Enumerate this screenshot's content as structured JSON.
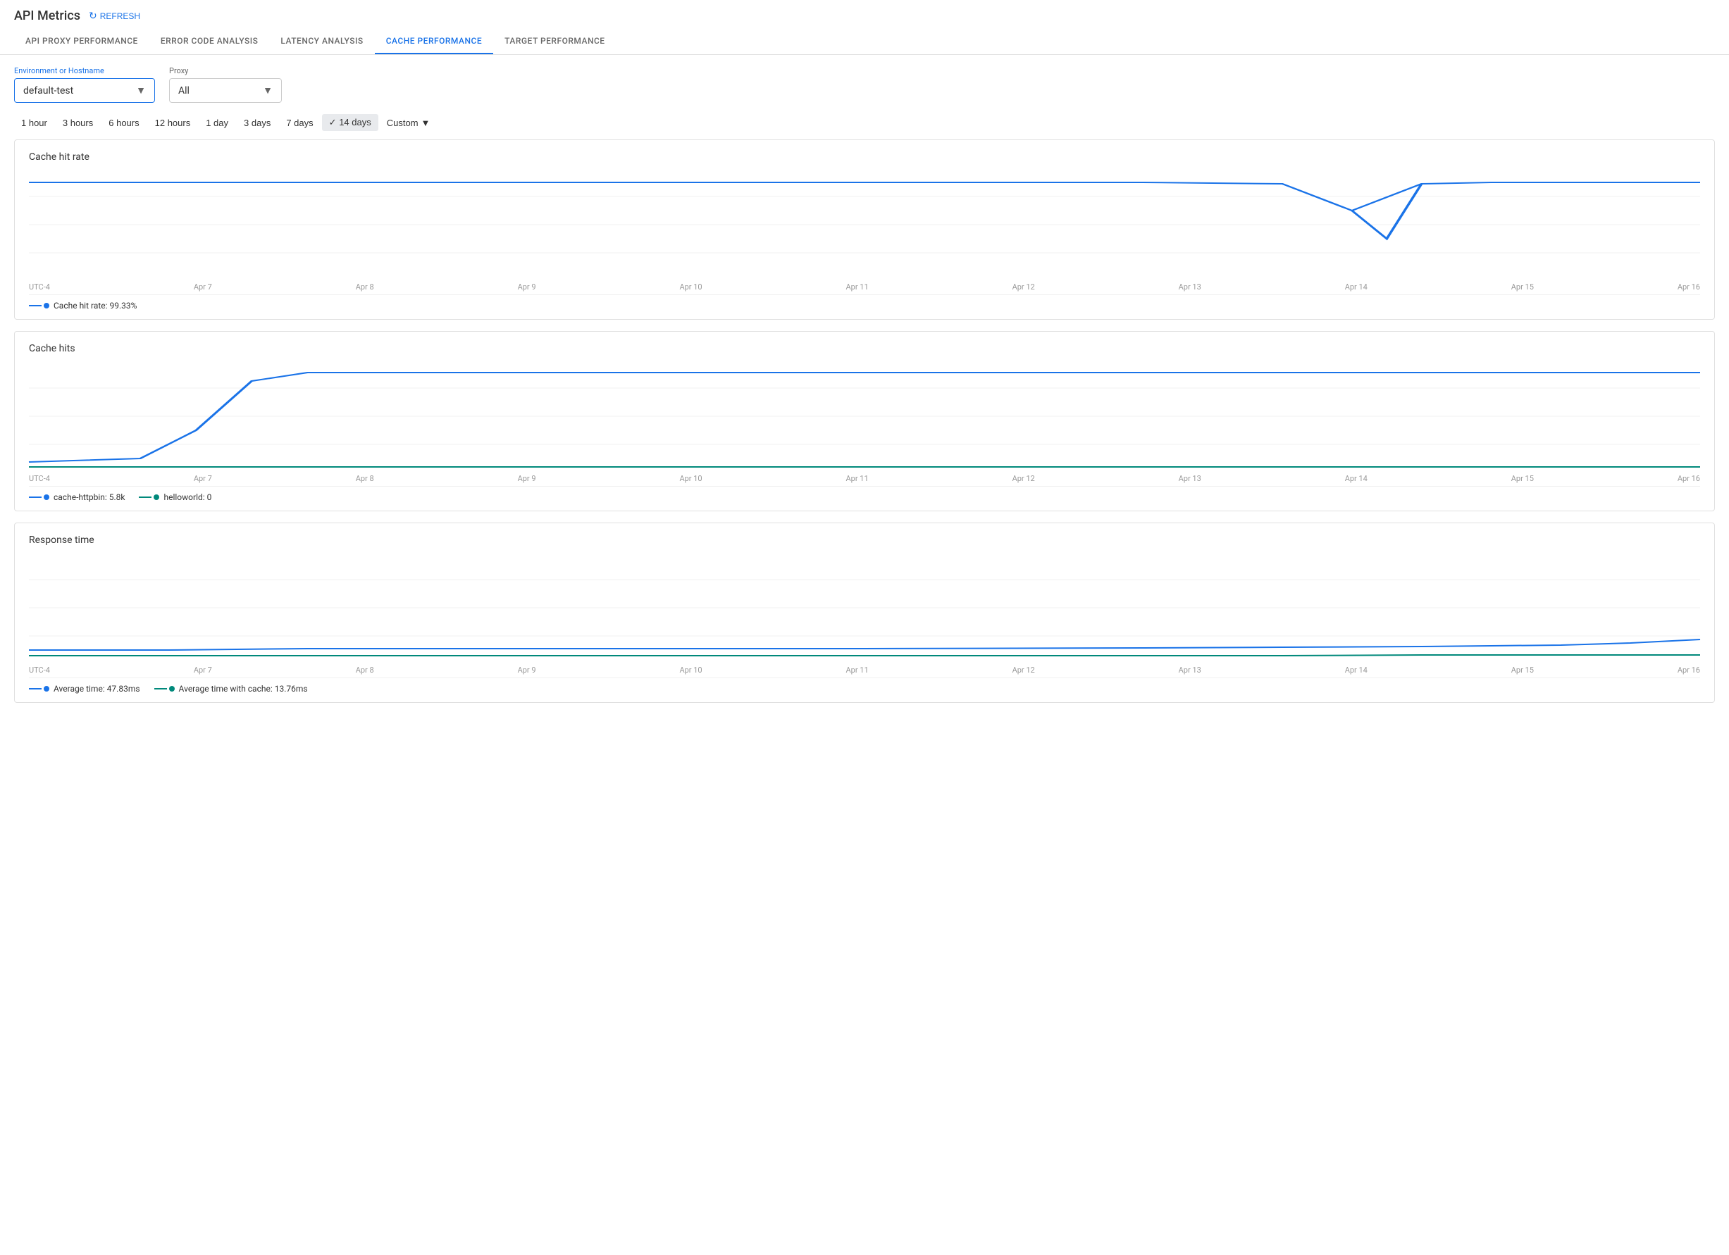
{
  "header": {
    "title": "API Metrics",
    "refresh_label": "REFRESH"
  },
  "tabs": [
    {
      "id": "api-proxy",
      "label": "API PROXY PERFORMANCE",
      "active": false
    },
    {
      "id": "error-code",
      "label": "ERROR CODE ANALYSIS",
      "active": false
    },
    {
      "id": "latency",
      "label": "LATENCY ANALYSIS",
      "active": false
    },
    {
      "id": "cache",
      "label": "CACHE PERFORMANCE",
      "active": true
    },
    {
      "id": "target",
      "label": "TARGET PERFORMANCE",
      "active": false
    }
  ],
  "controls": {
    "environment_label": "Environment or Hostname",
    "environment_value": "default-test",
    "proxy_label": "Proxy",
    "proxy_value": "All"
  },
  "time_filters": [
    {
      "label": "1 hour",
      "active": false
    },
    {
      "label": "3 hours",
      "active": false
    },
    {
      "label": "6 hours",
      "active": false
    },
    {
      "label": "12 hours",
      "active": false
    },
    {
      "label": "1 day",
      "active": false
    },
    {
      "label": "3 days",
      "active": false
    },
    {
      "label": "7 days",
      "active": false
    },
    {
      "label": "14 days",
      "active": true
    },
    {
      "label": "Custom",
      "active": false
    }
  ],
  "charts": {
    "cache_hit_rate": {
      "title": "Cache hit rate",
      "x_labels": [
        "UTC-4",
        "Apr 7",
        "Apr 8",
        "Apr 9",
        "Apr 10",
        "Apr 11",
        "Apr 12",
        "Apr 13",
        "Apr 14",
        "Apr 15",
        "Apr 16"
      ],
      "legend": [
        {
          "label": "Cache hit rate: 99.33%",
          "color": "blue"
        }
      ]
    },
    "cache_hits": {
      "title": "Cache hits",
      "x_labels": [
        "UTC-4",
        "Apr 7",
        "Apr 8",
        "Apr 9",
        "Apr 10",
        "Apr 11",
        "Apr 12",
        "Apr 13",
        "Apr 14",
        "Apr 15",
        "Apr 16"
      ],
      "legend": [
        {
          "label": "cache-httpbin: 5.8k",
          "color": "blue"
        },
        {
          "label": "helloworld: 0",
          "color": "teal"
        }
      ]
    },
    "response_time": {
      "title": "Response time",
      "x_labels": [
        "UTC-4",
        "Apr 7",
        "Apr 8",
        "Apr 9",
        "Apr 10",
        "Apr 11",
        "Apr 12",
        "Apr 13",
        "Apr 14",
        "Apr 15",
        "Apr 16"
      ],
      "legend": [
        {
          "label": "Average time: 47.83ms",
          "color": "blue"
        },
        {
          "label": "Average time with cache: 13.76ms",
          "color": "teal"
        }
      ]
    }
  },
  "colors": {
    "blue": "#1a73e8",
    "teal": "#00897b",
    "active_tab": "#1a73e8",
    "grid_line": "#e0e0e0"
  }
}
